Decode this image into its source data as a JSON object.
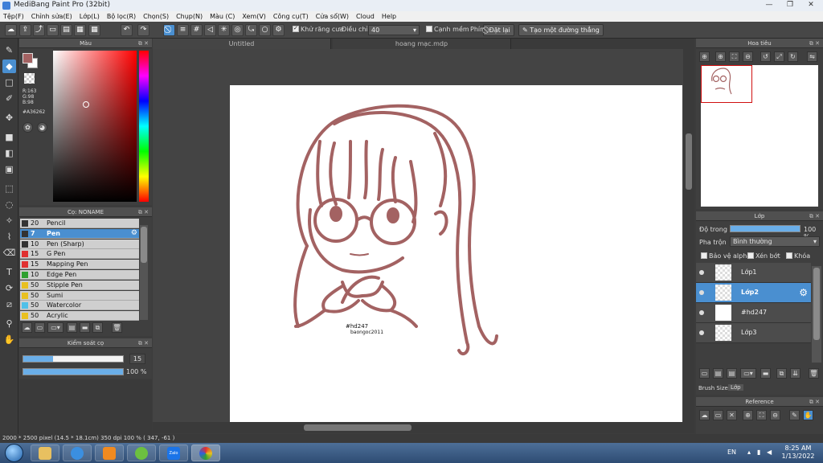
{
  "window": {
    "title": "MediBang Paint Pro (32bit)",
    "minimize": "—",
    "maximize": "❐",
    "close": "✕"
  },
  "menu": [
    "Tệp(F)",
    "Chỉnh sửa(E)",
    "Lớp(L)",
    "Bộ lọc(R)",
    "Chọn(S)",
    "Chụp(N)",
    "Màu (C)",
    "Xem(V)",
    "Công cụ(T)",
    "Cửa sổ(W)",
    "Cloud",
    "Help"
  ],
  "toolbar": {
    "antialias_label": "Khử răng cưa",
    "adjust_label": "Điều chỉnh",
    "adjust_value": "40",
    "smooth_label": "Cạnh mềm",
    "key_label": "Phím",
    "reset_label": "Đặt lại",
    "straight_line_label": "Tạo một đường thẳng"
  },
  "color_panel": {
    "title": "Màu",
    "rgb_r": "R:163",
    "rgb_g": "G:98",
    "rgb_b": "B:98",
    "hex": "#A36262",
    "fg_color": "#a36262"
  },
  "brush_panel": {
    "title": "Cọ: NONAME",
    "brushes": [
      {
        "size": "20",
        "name": "Pencil",
        "color": "#333333"
      },
      {
        "size": "7",
        "name": "Pen",
        "color": "#333333"
      },
      {
        "size": "10",
        "name": "Pen (Sharp)",
        "color": "#333333"
      },
      {
        "size": "15",
        "name": "G Pen",
        "color": "#e03030"
      },
      {
        "size": "15",
        "name": "Mapping Pen",
        "color": "#e03030"
      },
      {
        "size": "10",
        "name": "Edge Pen",
        "color": "#30a030"
      },
      {
        "size": "50",
        "name": "Stipple Pen",
        "color": "#e8c020"
      },
      {
        "size": "50",
        "name": "Sumi",
        "color": "#e8c020"
      },
      {
        "size": "50",
        "name": "Watercolor",
        "color": "#50c0e8"
      },
      {
        "size": "50",
        "name": "Acrylic",
        "color": "#e8c020"
      }
    ]
  },
  "brush_control": {
    "title": "Kiểm soát cọ",
    "size_value": "15",
    "size_fraction": 0.3,
    "opacity_value": "100 %",
    "opacity_fraction": 1.0
  },
  "tabs": [
    "Untitled",
    "hoang mạc.mdp"
  ],
  "canvas_text": {
    "tag1": "#hd247",
    "tag2": "baongoc2011"
  },
  "navigator": {
    "title": "Hoa tiêu"
  },
  "layer_panel": {
    "title": "Lớp",
    "opacity_label": "Độ trong",
    "opacity_value": "100 %",
    "blend_label": "Pha trộn",
    "blend_value": "Bình thường",
    "protect_alpha": "Bảo vệ alpha",
    "clipping": "Xén bớt",
    "lock": "Khóa",
    "layers": [
      "Lớp1",
      "Lớp2",
      "#hd247",
      "Lớp3"
    ],
    "brush_size_tab": "Brush Size",
    "layer_tab": "Lớp"
  },
  "reference_panel": {
    "title": "Reference"
  },
  "status": "2000 * 2500 pixel  (14.5 * 18.1cm)  350 dpi  100 %  ( 347, -61 )",
  "taskbar": {
    "lang": "EN",
    "time": "8:25 AM",
    "date": "1/13/2022",
    "zalo": "Zalo"
  }
}
